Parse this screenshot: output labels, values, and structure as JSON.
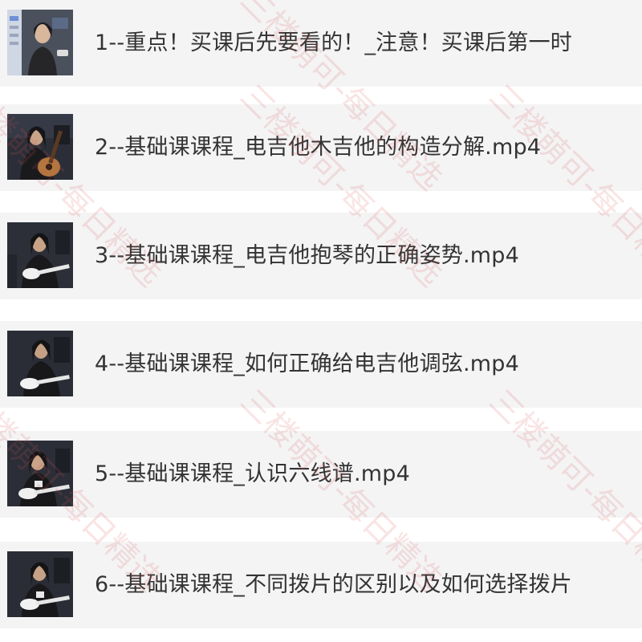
{
  "files": [
    {
      "name": "1--重点！买课后先要看的！_注意！买课后第一时",
      "thumbnail": "thumb-presenter-video"
    },
    {
      "name": "2--基础课课程_电吉他木吉他的构造分解.mp4",
      "thumbnail": "thumb-guitarist-acoustic"
    },
    {
      "name": "3--基础课课程_电吉他抱琴的正确姿势.mp4",
      "thumbnail": "thumb-guitarist-electric"
    },
    {
      "name": "4--基础课课程_如何正确给电吉他调弦.mp4",
      "thumbnail": "thumb-guitarist-electric"
    },
    {
      "name": "5--基础课课程_认识六线谱.mp4",
      "thumbnail": "thumb-guitarist-electric"
    },
    {
      "name": "6--基础课课程_不同拨片的区别以及如何选择拨片",
      "thumbnail": "thumb-guitarist-electric"
    }
  ],
  "watermark": {
    "text": "三楼萌可-每日精选",
    "color": "#dc5a5a"
  }
}
